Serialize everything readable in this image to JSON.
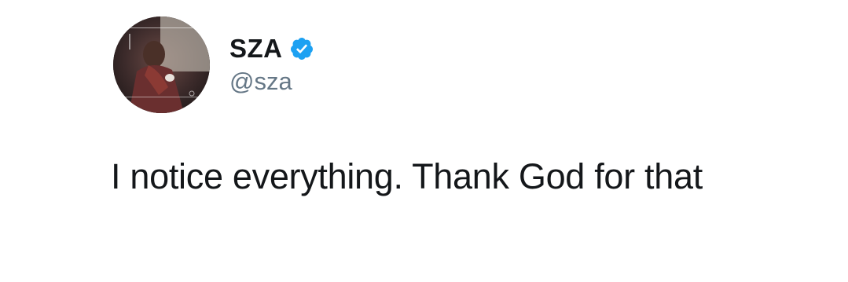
{
  "tweet": {
    "author": {
      "display_name": "SZA",
      "handle": "@sza",
      "verified": true,
      "avatar_icon": "profile-photo",
      "verified_icon": "verified-badge-icon",
      "verified_color": "#1da1f2"
    },
    "text": "I notice everything. Thank God for that"
  }
}
